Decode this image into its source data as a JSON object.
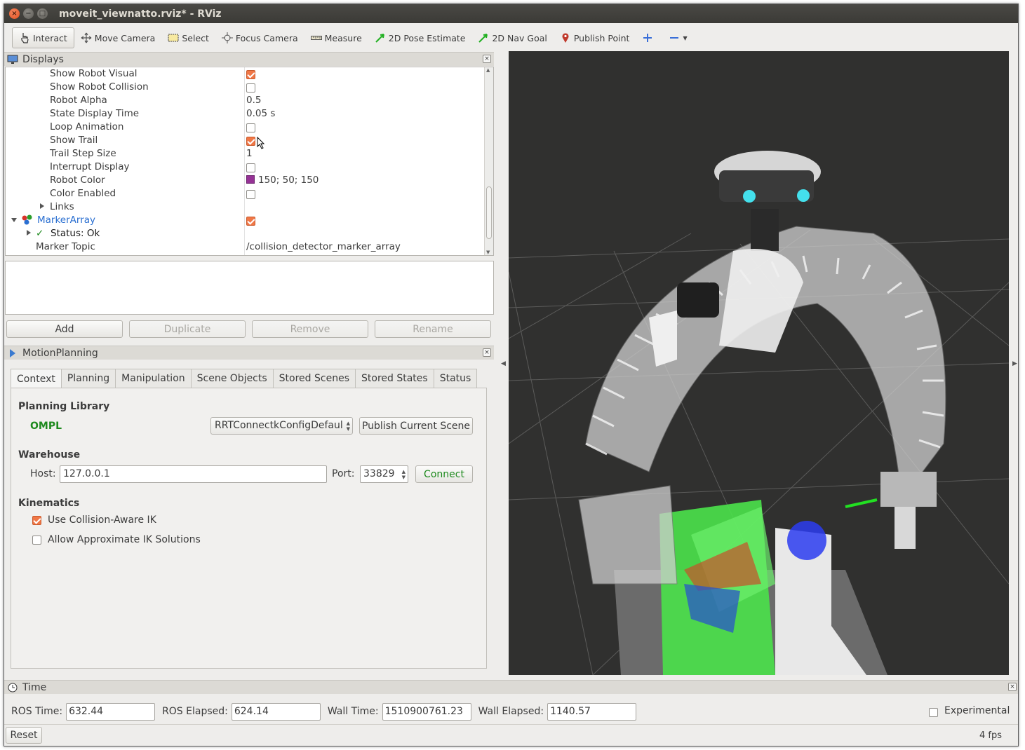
{
  "window": {
    "title": "moveit_viewnatto.rviz* - RViz"
  },
  "toolbar": {
    "tools": [
      {
        "label": "Interact",
        "icon": "hand-cursor-icon"
      },
      {
        "label": "Move Camera",
        "icon": "move-arrows-icon"
      },
      {
        "label": "Select",
        "icon": "select-box-icon"
      },
      {
        "label": "Focus Camera",
        "icon": "focus-target-icon"
      },
      {
        "label": "Measure",
        "icon": "ruler-icon"
      },
      {
        "label": "2D Pose Estimate",
        "icon": "green-arrow-icon"
      },
      {
        "label": "2D Nav Goal",
        "icon": "green-arrow-icon"
      },
      {
        "label": "Publish Point",
        "icon": "map-pin-icon"
      }
    ]
  },
  "displays": {
    "title": "Displays",
    "rows": [
      {
        "name": "Show Robot Visual",
        "value": "",
        "checkbox": true
      },
      {
        "name": "Show Robot Collision",
        "value": "",
        "checkbox": false
      },
      {
        "name": "Robot Alpha",
        "value": "0.5"
      },
      {
        "name": "State Display Time",
        "value": "0.05 s"
      },
      {
        "name": "Loop Animation",
        "value": "",
        "checkbox": false
      },
      {
        "name": "Show Trail",
        "value": "",
        "checkbox": true
      },
      {
        "name": "Trail Step Size",
        "value": "1"
      },
      {
        "name": "Interrupt Display",
        "value": "",
        "checkbox": false
      },
      {
        "name": "Robot Color",
        "value": "150; 50; 150",
        "color": "#963296"
      },
      {
        "name": "Color Enabled",
        "value": "",
        "checkbox": false
      },
      {
        "name": "Links",
        "value": ""
      },
      {
        "name": "MarkerArray",
        "value": "",
        "checkbox": true
      },
      {
        "name": "Status: Ok",
        "value": ""
      },
      {
        "name": "Marker Topic",
        "value": "/collision_detector_marker_array"
      }
    ],
    "buttons": {
      "add": "Add",
      "duplicate": "Duplicate",
      "remove": "Remove",
      "rename": "Rename"
    }
  },
  "motion_planning": {
    "title": "MotionPlanning",
    "tabs": [
      "Context",
      "Planning",
      "Manipulation",
      "Scene Objects",
      "Stored Scenes",
      "Stored States",
      "Status"
    ],
    "planning_library": {
      "label": "Planning Library",
      "library": "OMPL",
      "planner": "RRTConnectkConfigDefaul",
      "publish_button": "Publish Current Scene"
    },
    "warehouse": {
      "label": "Warehouse",
      "host_label": "Host:",
      "host": "127.0.0.1",
      "port_label": "Port:",
      "port": "33829",
      "connect_button": "Connect"
    },
    "kinematics": {
      "label": "Kinematics",
      "collision_aware_ik": "Use Collision-Aware IK",
      "approx_ik": "Allow Approximate IK Solutions"
    }
  },
  "time": {
    "title": "Time",
    "ros_time_label": "ROS Time:",
    "ros_time": "632.44",
    "ros_elapsed_label": "ROS Elapsed:",
    "ros_elapsed": "624.14",
    "wall_time_label": "Wall Time:",
    "wall_time": "1510900761.23",
    "wall_elapsed_label": "Wall Elapsed:",
    "wall_elapsed": "1140.57",
    "experimental_label": "Experimental",
    "reset_button": "Reset",
    "fps": "4 fps"
  },
  "colors": {
    "accent_orange": "#f07746",
    "ok_green": "#1e8a1e",
    "viewport_bg": "#30302f",
    "marker_array_blue": "#2a6fd1"
  }
}
